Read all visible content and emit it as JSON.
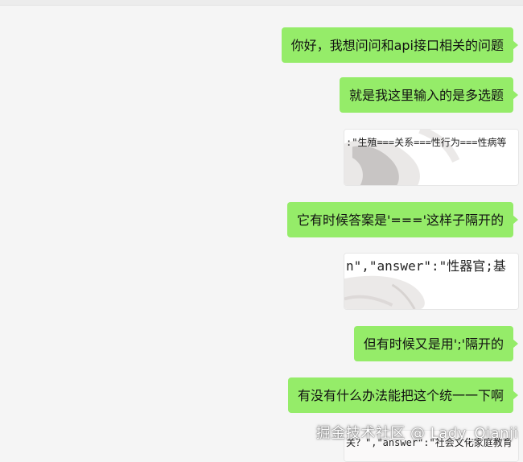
{
  "chat": {
    "messages": [
      {
        "type": "text",
        "text": "你好，我想问问和api接口相关的问题"
      },
      {
        "type": "text",
        "text": "就是我这里输入的是多选题"
      },
      {
        "type": "image",
        "text": ":\"生殖===关系===性行为===性病等"
      },
      {
        "type": "text",
        "text": "它有时候答案是'==='这样子隔开的"
      },
      {
        "type": "image",
        "text": "n\",\"answer\":\"性器官;基"
      },
      {
        "type": "text",
        "text": "但有时候又是用';'隔开的"
      },
      {
        "type": "text",
        "text": "有没有什么办法能把这个统一一下啊"
      },
      {
        "type": "image",
        "text": "关？\",\"answer\":\"社会文化家庭教育"
      }
    ]
  },
  "watermark": {
    "text": "掘金技术社区 @ Lady_Qianji"
  },
  "colors": {
    "bubble_green": "#95ec69",
    "background": "#f5f5f5"
  }
}
